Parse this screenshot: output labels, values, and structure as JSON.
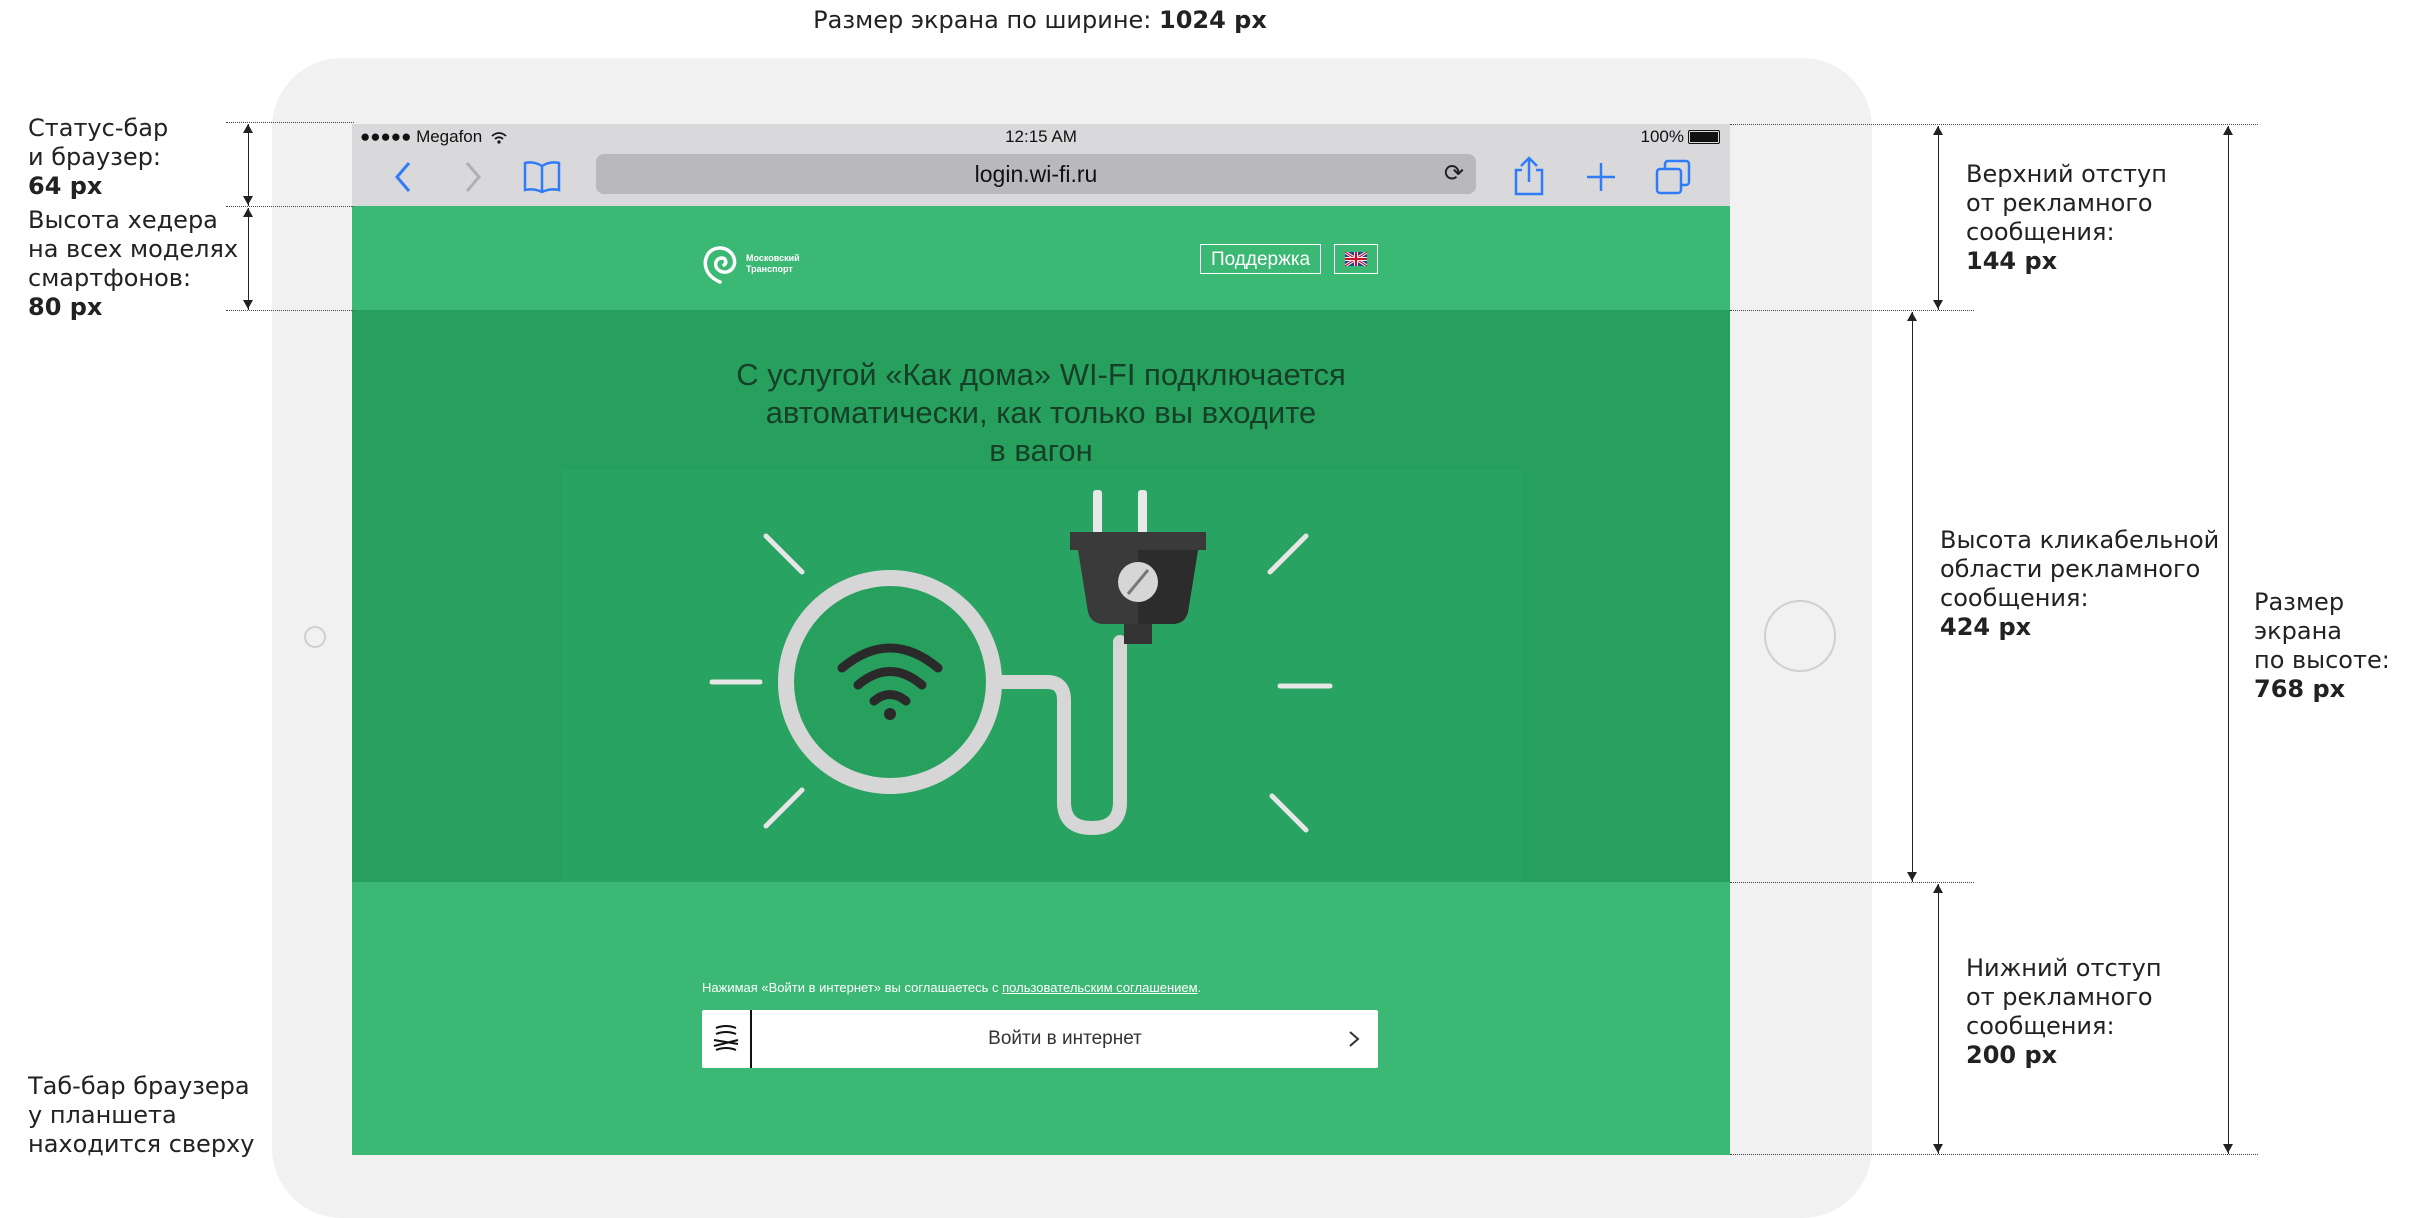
{
  "caption_top": {
    "text": "Размер экрана по ширине: ",
    "value": "1024 px"
  },
  "statusbar": {
    "carrier": "●●●●● Megafon",
    "time": "12:15 AM",
    "battery": "100%"
  },
  "browser": {
    "url": "login.wi-fi.ru"
  },
  "site_header": {
    "logo_line1": "Московский",
    "logo_line2": "Транспорт",
    "support_label": "Поддержка",
    "language_flag": "uk-flag-icon"
  },
  "ad": {
    "headline_line1": "С услугой «Как дома» WI-FI подключается",
    "headline_line2": "автоматически, как только вы входите",
    "headline_line3": "в вагон"
  },
  "footer": {
    "agreement_prefix": "Нажимая «Войти в интернет» вы соглашаетесь с ",
    "agreement_link": "пользовательским соглашением",
    "agreement_suffix": ".",
    "enter_label": "Войти в интернет"
  },
  "annotations": {
    "statusbar": {
      "line1": "Статус-бар",
      "line2": "и браузер:",
      "value": "64 px"
    },
    "header": {
      "line1": "Высота хедера",
      "line2": "на всех моделях",
      "line3": "смартфонов:",
      "value": "80 px"
    },
    "tabbar": {
      "line1": "Таб-бар браузера",
      "line2": "у планшета",
      "line3": "находится сверху"
    },
    "top_offset": {
      "line1": "Верхний отступ",
      "line2": "от рекламного",
      "line3": "сообщения:",
      "value": "144 px"
    },
    "ad_height": {
      "line1": "Высота кликабельной",
      "line2": "области рекламного",
      "line3": "сообщения:",
      "value": "424 px"
    },
    "bottom_offset": {
      "line1": "Нижний отступ",
      "line2": "от рекламного",
      "line3": "сообщения:",
      "value": "200 px"
    },
    "screen_height": {
      "line1": "Размер экрана",
      "line2": "по высоте:",
      "value": "768 px"
    }
  },
  "colors": {
    "green": "#3bb874",
    "ad_green": "#27a05e",
    "link_blue": "#2f7cf6"
  }
}
